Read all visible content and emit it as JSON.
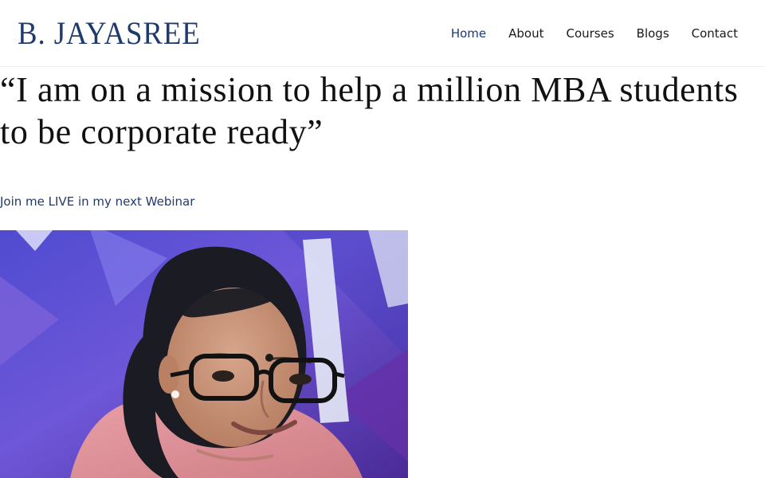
{
  "brand": {
    "logo_text": "B. JAYASREE"
  },
  "nav": {
    "items": [
      {
        "label": "Home",
        "active": true
      },
      {
        "label": "About",
        "active": false
      },
      {
        "label": "Courses",
        "active": false
      },
      {
        "label": "Blogs",
        "active": false
      },
      {
        "label": "Contact",
        "active": false
      }
    ]
  },
  "hero": {
    "quote": "“I am on a mission to help a million MBA students to be corporate ready”",
    "cta_text": "Join me LIVE in my next Webinar"
  },
  "colors": {
    "brand_navy": "#1f3a6e",
    "text": "#111111",
    "photo_background": "#5a52c8"
  }
}
